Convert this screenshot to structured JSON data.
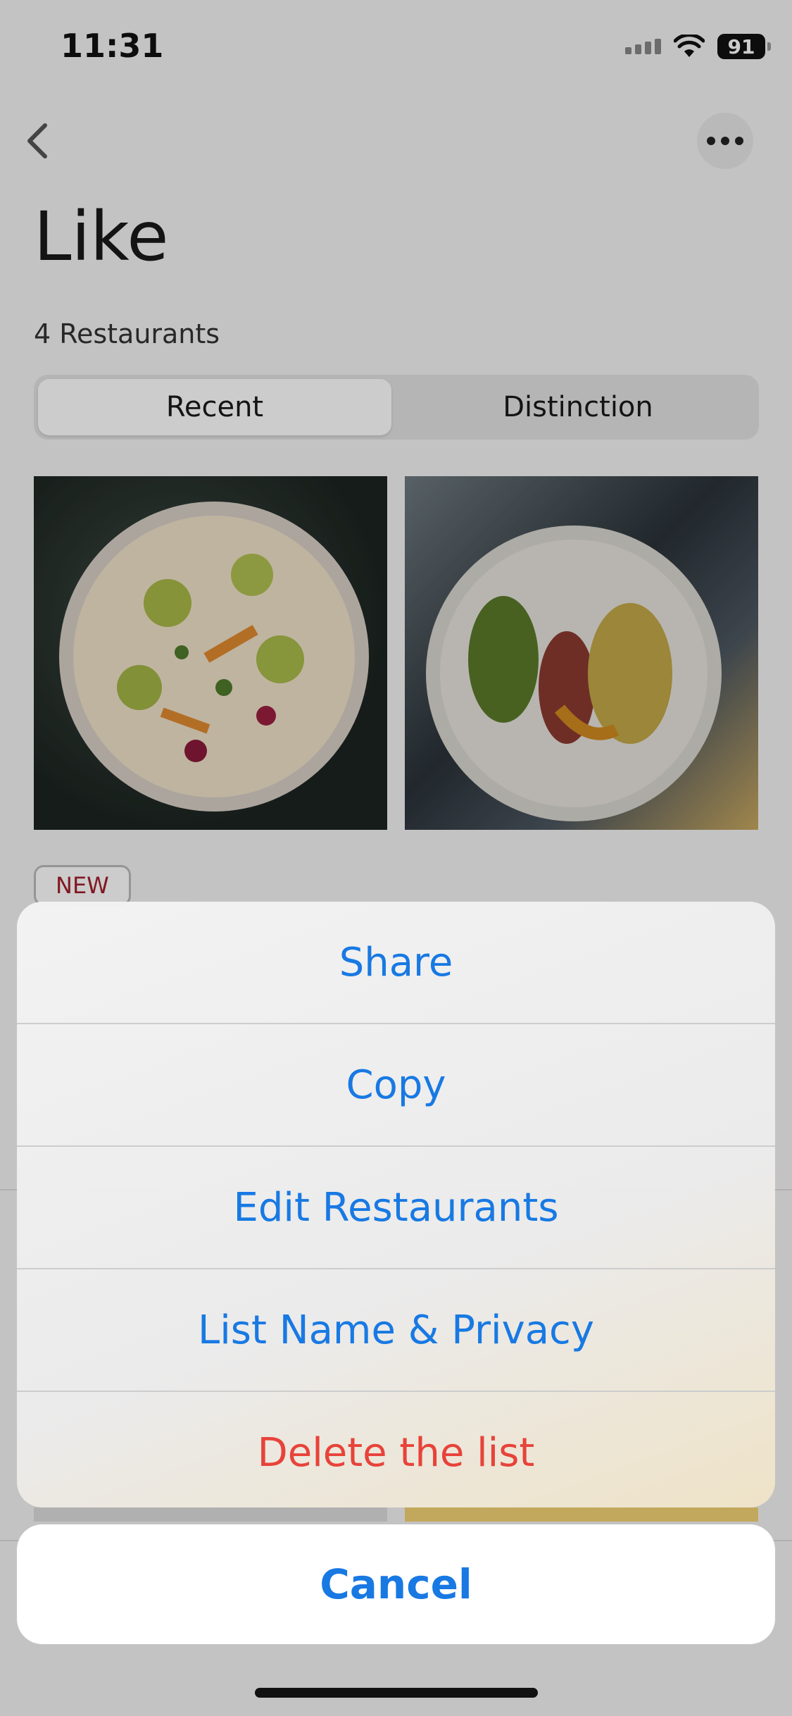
{
  "status_bar": {
    "time": "11:31",
    "battery": "91"
  },
  "header": {
    "title": "Like",
    "count": "4 Restaurants"
  },
  "tabs": [
    {
      "label": "Recent",
      "active": true
    },
    {
      "label": "Distinction",
      "active": false
    }
  ],
  "badge": "NEW",
  "action_sheet": {
    "items": [
      {
        "label": "Share"
      },
      {
        "label": "Copy"
      },
      {
        "label": "Edit Restaurants"
      },
      {
        "label": "List Name & Privacy"
      },
      {
        "label": "Delete the list",
        "destructive": true
      }
    ],
    "cancel_label": "Cancel"
  },
  "colors": {
    "accent": "#1879e3",
    "destructive": "#e7433a",
    "badge": "#a21e2c"
  },
  "icons": {
    "back": "chevron-left-icon",
    "more": "ellipsis-icon",
    "wifi": "wifi-icon",
    "signal": "signal-icon",
    "battery": "battery-icon"
  }
}
